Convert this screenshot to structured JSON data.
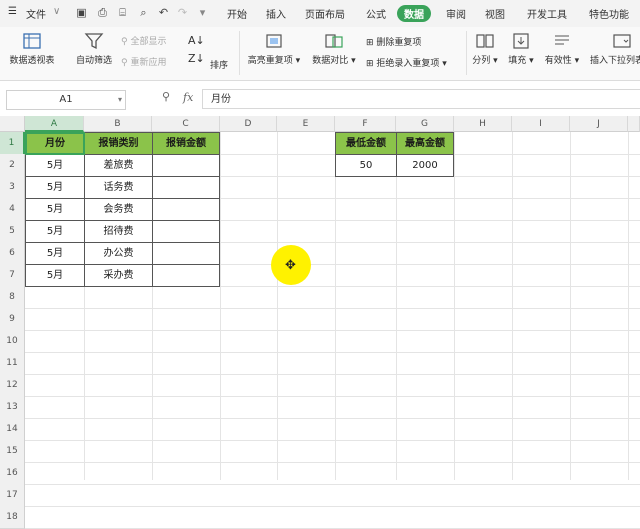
{
  "menu": {
    "file": "文件",
    "tabs": [
      "开始",
      "插入",
      "页面布局",
      "公式",
      "数据",
      "审阅",
      "视图",
      "开发工具",
      "特色功能"
    ],
    "active_tab": "数据"
  },
  "ribbon": {
    "pivot": "数据透视表",
    "autofilter": "自动筛选",
    "show_all": "全部显示",
    "reapply": "重新应用",
    "sort": "排序",
    "highlight_dup": "高亮重复项",
    "compare": "数据对比",
    "remove_dup": "删除重复项",
    "reject_dup": "拒绝录入重复项",
    "split": "分列",
    "fill": "填充",
    "validity": "有效性",
    "dropdown": "插入下拉列表"
  },
  "formula_bar": {
    "name_box": "A1",
    "fx": "fx",
    "content": "月份"
  },
  "columns": [
    "A",
    "B",
    "C",
    "D",
    "E",
    "F",
    "G",
    "H",
    "I",
    "J"
  ],
  "rows": [
    "1",
    "2",
    "3",
    "4",
    "5",
    "6",
    "7",
    "8",
    "9",
    "10",
    "11",
    "12",
    "13",
    "14",
    "15",
    "16",
    "17",
    "18"
  ],
  "table1": {
    "headers": [
      "月份",
      "报销类别",
      "报销金额"
    ],
    "rows": [
      [
        "5月",
        "差旅费",
        ""
      ],
      [
        "5月",
        "话务费",
        ""
      ],
      [
        "5月",
        "会务费",
        ""
      ],
      [
        "5月",
        "招待费",
        ""
      ],
      [
        "5月",
        "办公费",
        ""
      ],
      [
        "5月",
        "采办费",
        ""
      ]
    ]
  },
  "table2": {
    "headers": [
      "最低金额",
      "最高金额"
    ],
    "values": [
      "50",
      "2000"
    ]
  },
  "colors": {
    "accent": "#3aa35a",
    "header_fill": "#8bc34a",
    "cursor_highlight": "#fff200"
  }
}
